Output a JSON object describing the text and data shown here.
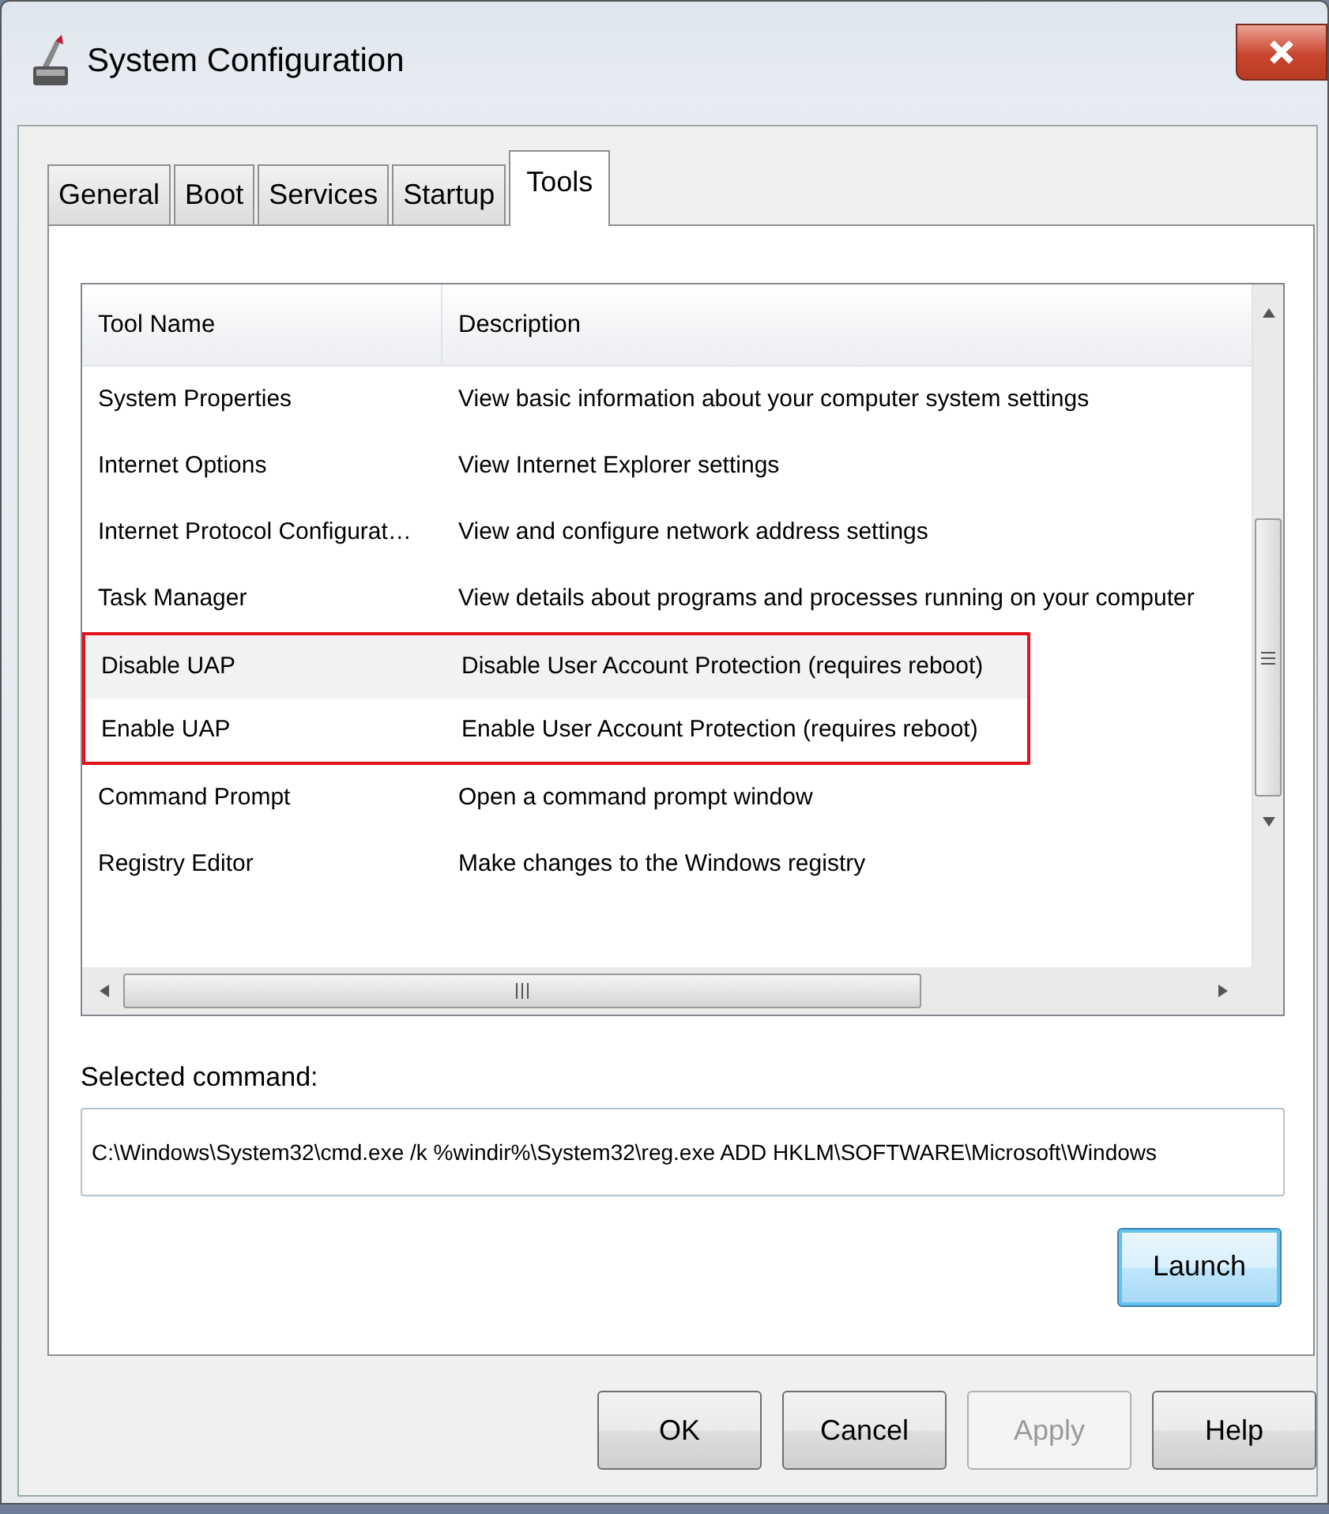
{
  "window": {
    "title": "System Configuration"
  },
  "tabs": [
    {
      "label": "General",
      "selected": false
    },
    {
      "label": "Boot",
      "selected": false
    },
    {
      "label": "Services",
      "selected": false
    },
    {
      "label": "Startup",
      "selected": false
    },
    {
      "label": "Tools",
      "selected": true
    }
  ],
  "table": {
    "columns": [
      "Tool Name",
      "Description"
    ],
    "rows": [
      {
        "cells": [
          "System Properties",
          "View basic information about your computer system settings"
        ],
        "highlighted": false,
        "hovered": false
      },
      {
        "cells": [
          "Internet Options",
          "View Internet Explorer settings"
        ],
        "highlighted": false,
        "hovered": false
      },
      {
        "cells": [
          "Internet Protocol Configurat…",
          "View and configure network address settings"
        ],
        "highlighted": false,
        "hovered": false
      },
      {
        "cells": [
          "Task Manager",
          "View details about programs and processes running on your computer"
        ],
        "highlighted": false,
        "hovered": false
      },
      {
        "cells": [
          "Disable UAP",
          "Disable User Account Protection (requires reboot)"
        ],
        "highlighted": true,
        "hovered": true
      },
      {
        "cells": [
          "Enable UAP",
          "Enable User Account Protection (requires reboot)"
        ],
        "highlighted": true,
        "hovered": false
      },
      {
        "cells": [
          "Command Prompt",
          "Open a command prompt window"
        ],
        "highlighted": false,
        "hovered": false
      },
      {
        "cells": [
          "Registry Editor",
          "Make changes to the Windows registry"
        ],
        "highlighted": false,
        "hovered": false
      }
    ]
  },
  "selected_command": {
    "label": "Selected command:",
    "value": "C:\\Windows\\System32\\cmd.exe /k %windir%\\System32\\reg.exe ADD HKLM\\SOFTWARE\\Microsoft\\Windows"
  },
  "launch_button": {
    "label": "Launch",
    "focused": true
  },
  "buttons": [
    {
      "label": "OK",
      "disabled": false
    },
    {
      "label": "Cancel",
      "disabled": false
    },
    {
      "label": "Apply",
      "disabled": true
    },
    {
      "label": "Help",
      "disabled": false
    }
  ]
}
